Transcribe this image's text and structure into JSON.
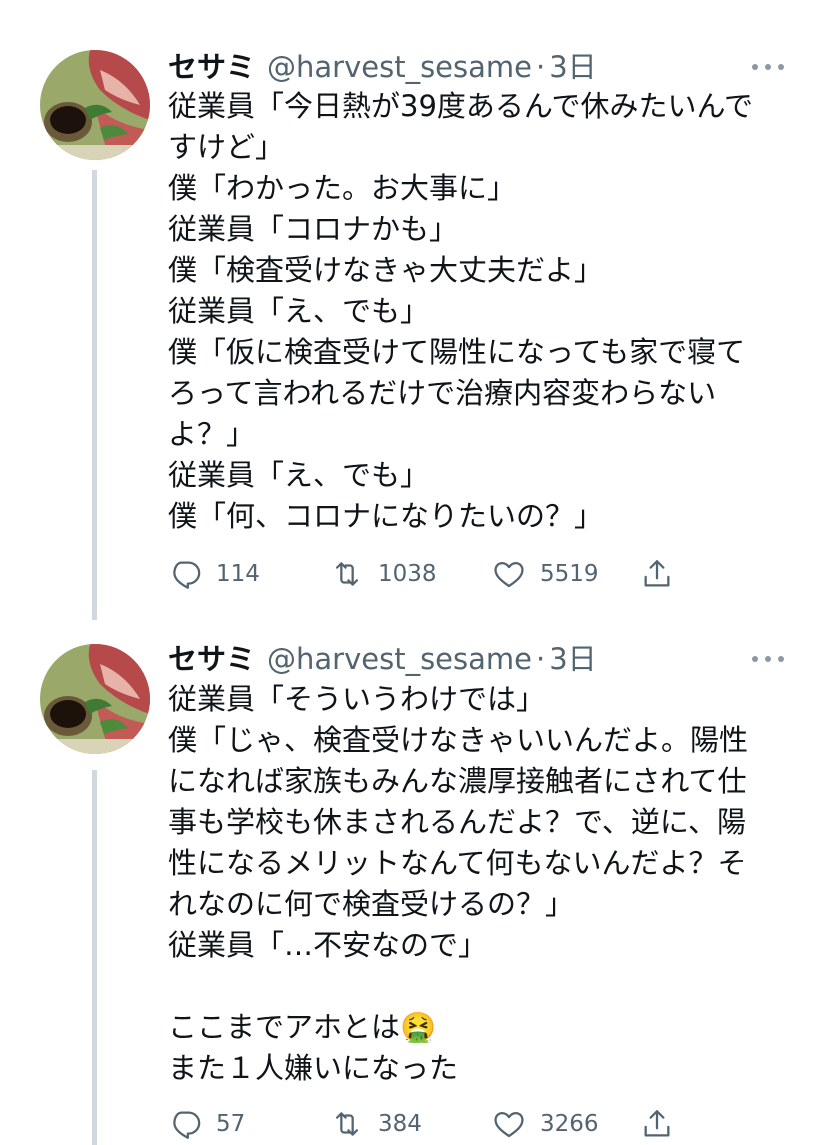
{
  "tweets": [
    {
      "name": "セサミ",
      "handle": "@harvest_sesame",
      "separator": "·",
      "time": "3日",
      "lines": [
        "従業員「今日熱が39度あるんで休みたいんで",
        "すけど」",
        "僕「わかった。お大事に」",
        "従業員「コロナかも」",
        "僕「検査受けなきゃ大丈夫だよ」",
        "従業員「え、でも」",
        "僕「仮に検査受けて陽性になっても家で寝て",
        "ろって言われるだけで治療内容変わらない",
        "よ？」",
        "従業員「え、でも」",
        "僕「何、コロナになりたいの？」"
      ],
      "replies": "114",
      "retweets": "1038",
      "likes": "5519"
    },
    {
      "name": "セサミ",
      "handle": "@harvest_sesame",
      "separator": "·",
      "time": "3日",
      "lines": [
        "従業員「そういうわけでは」",
        "僕「じゃ、検査受けなきゃいいんだよ。陽性",
        "になれば家族もみんな濃厚接触者にされて仕",
        "事も学校も休まされるんだよ？で、逆に、陽",
        "性になるメリットなんて何もないんだよ？そ",
        "れなのに何で検査受けるの？」",
        "従業員「…不安なので」",
        "",
        "ここまでアホとは🤮",
        "また１人嫌いになった"
      ],
      "replies": "57",
      "retweets": "384",
      "likes": "3266"
    }
  ],
  "colors": {
    "text": "#0f1419",
    "secondary": "#536471",
    "thread_line": "#cfd9de"
  },
  "icons": [
    "avatar-image",
    "more-icon",
    "reply-icon",
    "retweet-icon",
    "like-icon",
    "share-icon"
  ]
}
